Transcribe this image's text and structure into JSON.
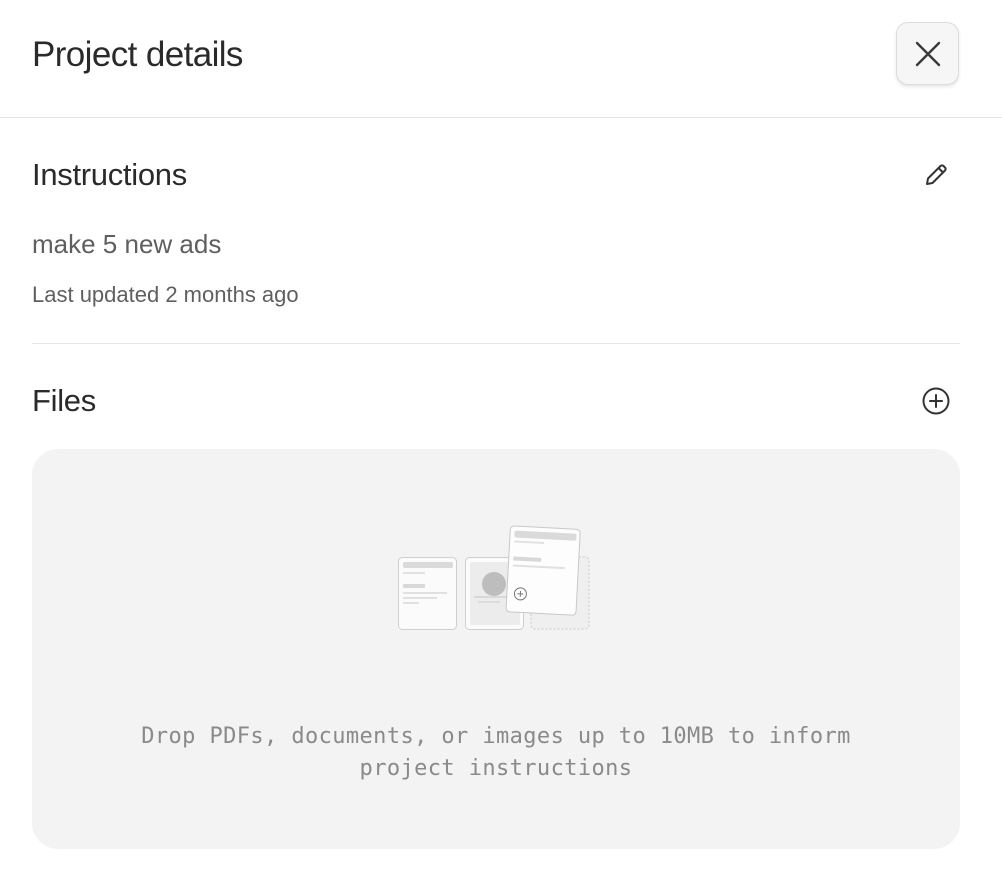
{
  "header": {
    "title": "Project details",
    "close_icon": "close-icon"
  },
  "instructions": {
    "heading": "Instructions",
    "edit_icon": "pencil-icon",
    "text": "make 5 new ads",
    "last_updated": "Last updated 2 months ago"
  },
  "files": {
    "heading": "Files",
    "add_icon": "plus-circle-icon",
    "dropzone_hint": "Drop PDFs, documents, or images up to 10MB to inform project instructions",
    "illustration_icon": "file-cards-illustration"
  },
  "colors": {
    "text_primary": "#2a2a2a",
    "text_secondary": "#5f5f5f",
    "dropzone_bg": "#f3f3f3",
    "hint_text": "#8a8a8a"
  }
}
